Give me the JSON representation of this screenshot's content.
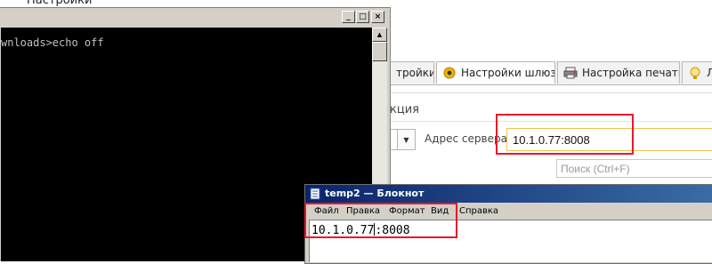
{
  "background_app": {
    "top_title": "Настройки",
    "tabs": [
      {
        "label": "тройки",
        "icon": ""
      },
      {
        "label": "Настройки шлюз",
        "icon": "gateway-settings-icon"
      },
      {
        "label": "Настройка печати",
        "icon": "print-settings-icon"
      },
      {
        "label": "Л",
        "icon": "license-icon"
      }
    ],
    "section_label": "кция",
    "server_address_label": "Адрес сервера:",
    "server_address_value": "10.1.0.77:8008",
    "search_placeholder": "Поиск (Ctrl+F)"
  },
  "console": {
    "output_line": "wnloads>echo off",
    "buttons": {
      "minimize": "_",
      "maximize": "□",
      "close": "×"
    }
  },
  "notepad": {
    "title": "temp2 — Блокнот",
    "menu": [
      "Файл",
      "Правка",
      "Формат",
      "Вид",
      "Справка"
    ],
    "text_before_caret": "10.1.0.77",
    "text_after_caret": ":8008"
  },
  "colors": {
    "highlight_box": "#e8192c",
    "input_focus_border": "#f0c44a",
    "console_bg": "#000000",
    "notepad_title_bar": "#0a246a"
  }
}
